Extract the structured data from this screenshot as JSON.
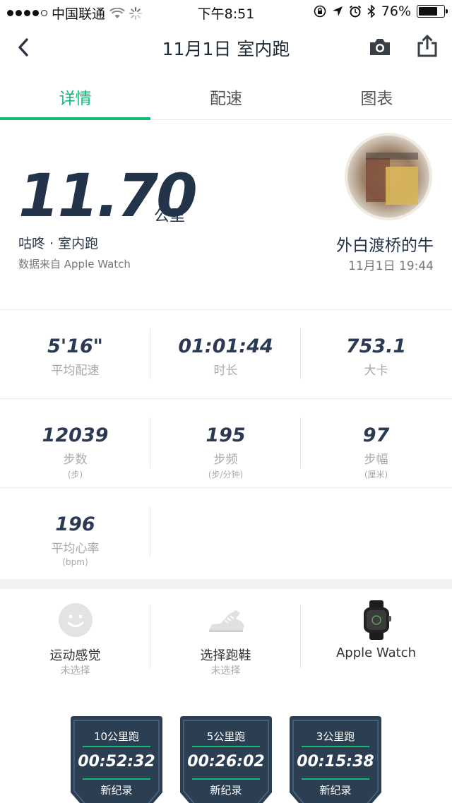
{
  "status_bar": {
    "carrier": "中国联通",
    "time": "下午8:51",
    "battery_percent": "76%",
    "battery_level": 0.76,
    "signal_dots_filled": 4
  },
  "nav": {
    "title": "11月1日 室内跑",
    "back_icon": "chevron-left-icon",
    "camera_icon": "camera-icon",
    "share_icon": "share-icon"
  },
  "tabs": [
    {
      "label": "详情",
      "active": true
    },
    {
      "label": "配速",
      "active": false
    },
    {
      "label": "图表",
      "active": false
    }
  ],
  "summary": {
    "distance": "11.70",
    "distance_unit": "公里",
    "run_type": "咕咚 · 室内跑",
    "data_source": "数据来自 Apple Watch",
    "user_name": "外白渡桥的牛",
    "datetime": "11月1日 19:44"
  },
  "stats": [
    [
      {
        "value": "5'16\"",
        "label": "平均配速",
        "unit": ""
      },
      {
        "value": "01:01:44",
        "label": "时长",
        "unit": ""
      },
      {
        "value": "753.1",
        "label": "大卡",
        "unit": ""
      }
    ],
    [
      {
        "value": "12039",
        "label": "步数",
        "unit": "(步)"
      },
      {
        "value": "195",
        "label": "步频",
        "unit": "(步/分钟)"
      },
      {
        "value": "97",
        "label": "步幅",
        "unit": "(厘米)"
      }
    ],
    [
      {
        "value": "196",
        "label": "平均心率",
        "unit": "(bpm)"
      }
    ]
  ],
  "feedback": [
    {
      "label": "运动感觉",
      "sub": "未选择",
      "icon": "smiley-icon"
    },
    {
      "label": "选择跑鞋",
      "sub": "未选择",
      "icon": "shoe-icon"
    },
    {
      "label": "Apple Watch",
      "sub": "",
      "icon": "apple-watch-icon"
    }
  ],
  "badges": [
    {
      "title": "10公里跑",
      "time": "00:52:32",
      "foot": "新纪录"
    },
    {
      "title": "5公里跑",
      "time": "00:26:02",
      "foot": "新纪录"
    },
    {
      "title": "3公里跑",
      "time": "00:15:38",
      "foot": "新纪录"
    }
  ],
  "colors": {
    "accent": "#17b978",
    "text_dark": "#22334a",
    "badge_bg": "#2c3e52"
  }
}
